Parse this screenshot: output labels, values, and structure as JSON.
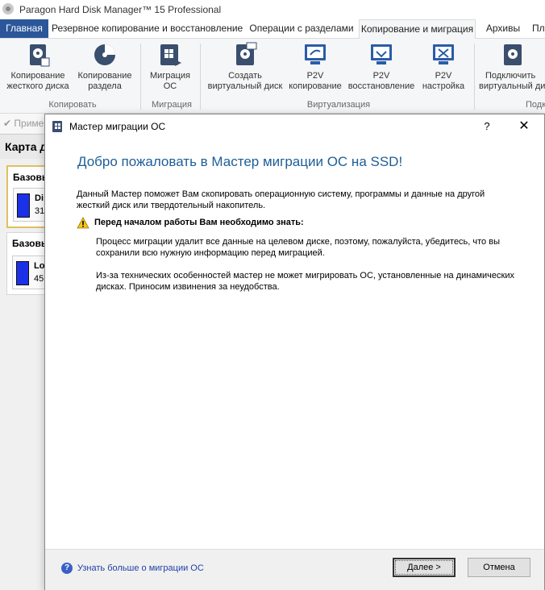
{
  "app": {
    "title": "Paragon Hard Disk Manager™ 15 Professional"
  },
  "tabs": [
    {
      "label": "Главная"
    },
    {
      "label": "Резервное копирование и восстановление"
    },
    {
      "label": "Операции с разделами"
    },
    {
      "label": "Копирование и миграция"
    },
    {
      "label": "Архивы"
    },
    {
      "label": "Пл"
    }
  ],
  "ribbon": {
    "buttons": [
      {
        "line1": "Копирование",
        "line2": "жесткого диска",
        "icon": "disk-copy-icon"
      },
      {
        "line1": "Копирование",
        "line2": "раздела",
        "icon": "partition-copy-icon"
      },
      {
        "line1": "Миграция",
        "line2": "ОС",
        "icon": "os-migration-icon"
      },
      {
        "line1": "Создать",
        "line2": "виртуальный диск",
        "icon": "create-virtual-disk-icon"
      },
      {
        "line1": "P2V",
        "line2": "копирование",
        "icon": "p2v-copy-icon"
      },
      {
        "line1": "P2V",
        "line2": "восстановление",
        "icon": "p2v-restore-icon"
      },
      {
        "line1": "P2V",
        "line2": "настройка",
        "icon": "p2v-adjust-icon"
      },
      {
        "line1": "Подключить",
        "line2": "виртуальный ди",
        "icon": "connect-virtual-disk-icon"
      }
    ],
    "groups": [
      {
        "label": "Копировать"
      },
      {
        "label": "Миграция"
      },
      {
        "label": "Виртуализация"
      },
      {
        "label": "Подк"
      }
    ]
  },
  "toolbar": {
    "apply_label": "Приме"
  },
  "diskmap": {
    "title": "Карта д",
    "disks": [
      {
        "header": "Базовы",
        "name": "Di",
        "size": "31"
      },
      {
        "header": "Базовы",
        "name": "Lo",
        "size": "45"
      }
    ]
  },
  "dialog": {
    "title": "Мастер миграции ОС",
    "help": "?",
    "close": "✕",
    "heading": "Добро пожаловать в Мастер миграции ОС на SSD!",
    "intro": "Данный Мастер поможет Вам скопировать операционную систему, программы и данные на другой жесткий диск или твердотельный накопитель.",
    "warning_title": "Перед началом работы Вам необходимо знать:",
    "para1": "Процесс миграции удалит все данные на целевом диске, поэтому, пожалуйста, убедитесь, что вы сохранили всю нужную информацию перед миграцией.",
    "para2": "Из-за технических особенностей мастер не может мигрировать ОС, установленные на динамических дисках. Приносим извинения за неудобства.",
    "learn_more": "Узнать больше о миграции ОС",
    "next_label": "Далее >",
    "cancel_label": "Отмена"
  },
  "colors": {
    "accent": "#2b579a",
    "heading": "#1e5e96",
    "link": "#1f3fa8",
    "disk_blue": "#1a31e8"
  }
}
